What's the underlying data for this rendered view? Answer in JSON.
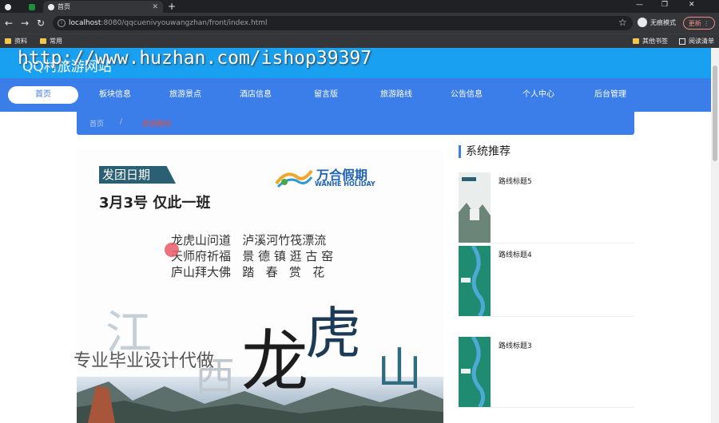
{
  "browser": {
    "tabs": [
      "首页"
    ],
    "new_tab": "+",
    "url_host": "localhost",
    "url_rest": ":8080/qqcuenivyouwangzhan/front/index.html",
    "incognito_label": "无痕模式",
    "update_label": "更新",
    "bookmarks": [
      "资料",
      "常用"
    ],
    "bookmarks_right": [
      "其他书签",
      "阅读清单"
    ],
    "window_controls": [
      "—",
      "❐",
      "✕"
    ]
  },
  "site": {
    "title": "QQ村旅游网站",
    "watermark": "http://www.huzhan.com/ishop39397",
    "nav": [
      "首页",
      "板块信息",
      "旅游景点",
      "酒店信息",
      "留言版",
      "旅游路线",
      "公告信息",
      "个人中心",
      "后台管理"
    ],
    "breadcrumb": [
      "首页",
      "/",
      "旅游路线"
    ]
  },
  "poster": {
    "tag": "发团日期",
    "date": "3月3号 仅此一班",
    "brand_cn": "万合假期",
    "brand_en": "WANHE HOLIDAY",
    "lines": [
      "龙虎山问道   泸溪河竹筏漂流",
      "天师府祈福   景 德 镇 逛 古 窑",
      "庐山拜大佛   踏   春   赏   花"
    ],
    "big_title": [
      "江",
      "西",
      "龙",
      "虎",
      "山"
    ],
    "promo": "专业毕业设计代做"
  },
  "sidebar": {
    "title": "系统推荐",
    "items": [
      "路线标题5",
      "路线标题4",
      "路线标题3"
    ]
  },
  "colors": {
    "header": "#1aa0f0",
    "nav": "#3b7de9",
    "accent_red": "#e4503a"
  }
}
